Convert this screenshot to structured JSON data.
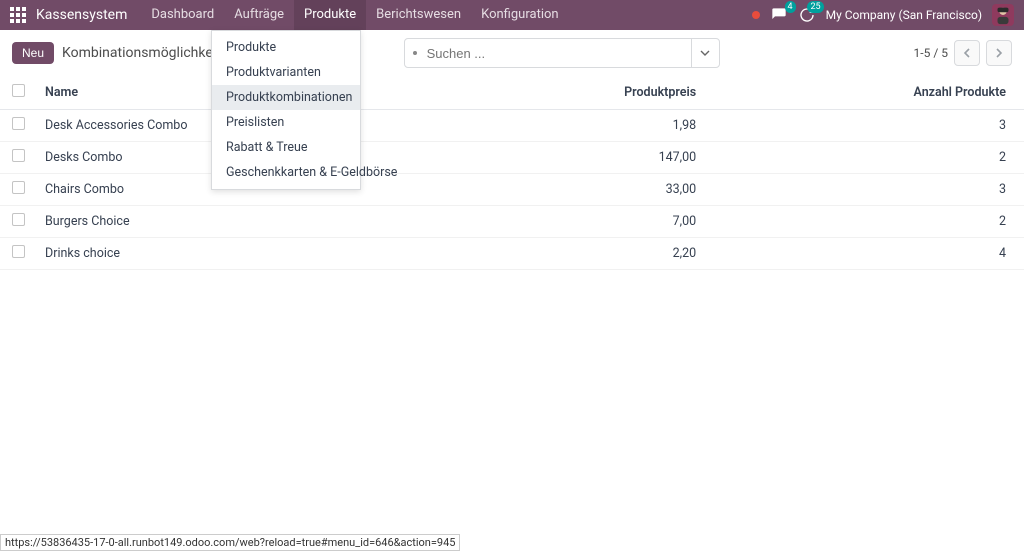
{
  "topbar": {
    "brand": "Kassensystem",
    "nav": [
      "Dashboard",
      "Aufträge",
      "Produkte",
      "Berichtswesen",
      "Konfiguration"
    ],
    "active_nav_index": 2,
    "chat_badge": "4",
    "activity_badge": "25",
    "company": "My Company (San Francisco)"
  },
  "control": {
    "new_label": "Neu",
    "breadcrumb": "Kombinationsmöglichkeiten",
    "search_placeholder": "Suchen ...",
    "pager": "1-5 / 5"
  },
  "dropdown": {
    "items": [
      "Produkte",
      "Produktvarianten",
      "Produktkombinationen",
      "Preislisten",
      "Rabatt & Treue",
      "Geschenkkarten & E-Geldbörse"
    ],
    "selected_index": 2
  },
  "table": {
    "headers": {
      "name": "Name",
      "price": "Produktpreis",
      "count": "Anzahl Produkte"
    },
    "rows": [
      {
        "name": "Desk Accessories Combo",
        "price": "1,98",
        "count": "3"
      },
      {
        "name": "Desks Combo",
        "price": "147,00",
        "count": "2"
      },
      {
        "name": "Chairs Combo",
        "price": "33,00",
        "count": "3"
      },
      {
        "name": "Burgers Choice",
        "price": "7,00",
        "count": "2"
      },
      {
        "name": "Drinks choice",
        "price": "2,20",
        "count": "4"
      }
    ]
  },
  "status_url": "https://53836435-17-0-all.runbot149.odoo.com/web?reload=true#menu_id=646&action=945"
}
